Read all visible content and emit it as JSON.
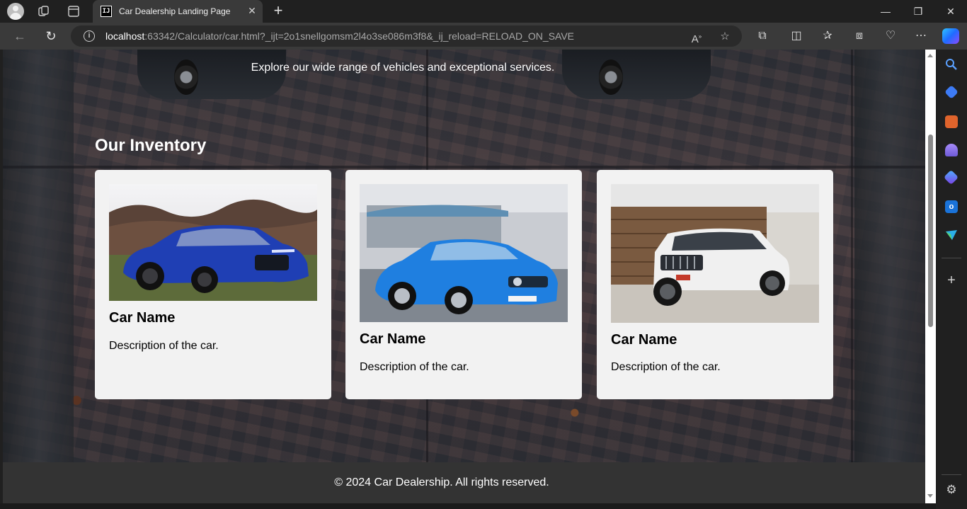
{
  "browser": {
    "tab_title": "Car Dealership Landing Page",
    "tab_favicon_text": "IJ",
    "url_host": "localhost",
    "url_rest": ":63342/Calculator/car.html?_ijt=2o1snellgomsm2l4o3se086m3f8&_ij_reload=RELOAD_ON_SAVE",
    "icons": {
      "back": "back-arrow-icon",
      "refresh": "refresh-icon",
      "info": "info-icon",
      "read_aloud": "read-aloud-icon",
      "favorite": "star-icon",
      "extensions": "puzzle-icon",
      "split": "split-screen-icon",
      "favorites": "favorites-icon",
      "collections": "collections-icon",
      "copilot": "copilot-icon",
      "more": "more-icon"
    }
  },
  "page": {
    "hero_subtitle": "Explore our wide range of vehicles and exceptional services.",
    "inventory_title": "Our Inventory",
    "cars": [
      {
        "name": "Car Name",
        "description": "Description of the car.",
        "color": "#1f3fb4",
        "image": "blue-audi-sedan"
      },
      {
        "name": "Car Name",
        "description": "Description of the car.",
        "color": "#1f7fe0",
        "image": "blue-mercedes-hatchback"
      },
      {
        "name": "Car Name",
        "description": "Description of the car.",
        "color": "#f0f0f0",
        "image": "white-jeep-suv"
      }
    ],
    "footer_text": "© 2024 Car Dealership. All rights reserved."
  },
  "colors": {
    "card_bg": "#f2f2f2",
    "footer_bg": "#333333",
    "chrome_bg": "#202020"
  }
}
